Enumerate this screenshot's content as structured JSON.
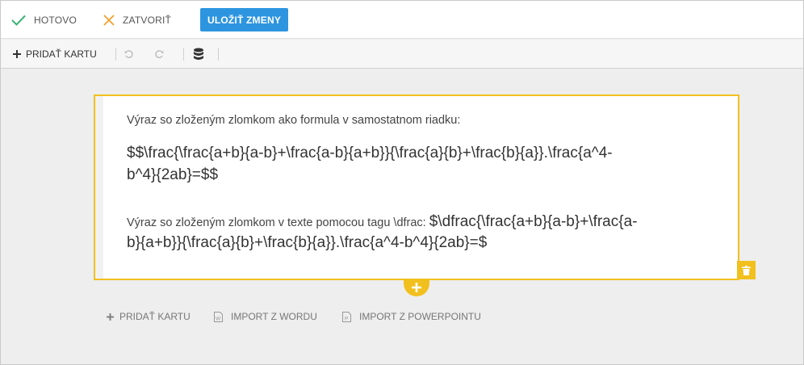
{
  "topbar": {
    "done_label": "HOTOVO",
    "close_label": "ZATVORIŤ",
    "save_label": "ULOŽIŤ ZMENY"
  },
  "toolbar": {
    "add_card_label": "PRIDAŤ KARTU"
  },
  "card": {
    "line1": "Výraz so zloženým zlomkom ako formula v samostatnom riadku:",
    "formula_line1": "$$\\frac{\\frac{a+b}{a-b}+\\frac{a-b}{a+b}}{\\frac{a}{b}+\\frac{b}{a}}.\\frac{a^4-",
    "formula_line2": "b^4}{2ab}=$$",
    "line3_text": "Výraz so zloženým zlomkom v texte pomocou tagu \\dfrac: ",
    "line3_formula": "$\\dfrac{\\frac{a+b}{a-b}+\\frac{a-",
    "line4": "b}{a+b}}{\\frac{a}{b}+\\frac{b}{a}}.\\frac{a^4-b^4}{2ab}=$"
  },
  "bottom": {
    "add_card_label": "PRIDAŤ KARTU",
    "import_word_label": "IMPORT Z WORDU",
    "import_ppt_label": "IMPORT Z POWERPOINTU"
  },
  "colors": {
    "accent_blue": "#2d95e0",
    "card_border": "#f2c01e",
    "check_green": "#3bb273",
    "close_orange": "#f0a030"
  }
}
